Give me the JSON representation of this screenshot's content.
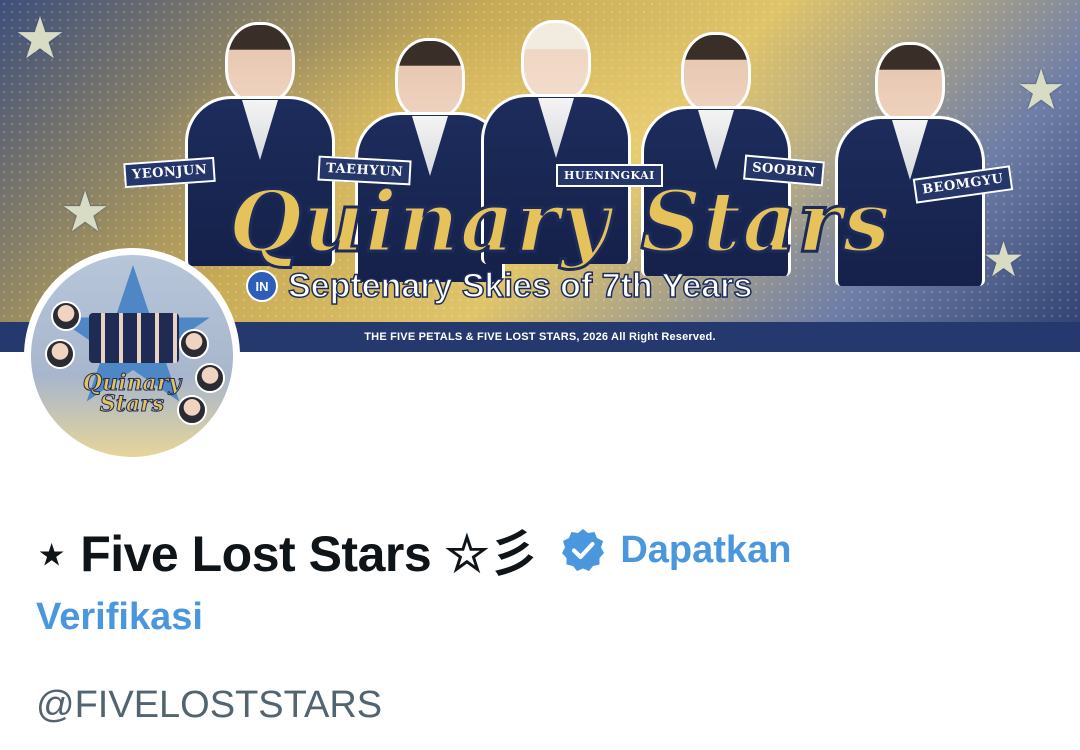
{
  "banner": {
    "title": "Quinary Stars",
    "in_badge": "IN",
    "subtitle": "Septenary Skies of 7th Years",
    "footer": "THE FIVE PETALS & FIVE LOST STARS, 2026 All Right Reserved.",
    "members": [
      "YEONJUN",
      "TAEHYUN",
      "HUENINGKAI",
      "SOOBIN",
      "BEOMGYU"
    ]
  },
  "avatar": {
    "title": "Quinary Stars"
  },
  "profile": {
    "display_name": "⋆ Five Lost Stars ☆彡",
    "verified_icon": "verified-badge-icon",
    "get_verified_part1": "Dapatkan",
    "get_verified_part2": "Verifikasi",
    "handle": "@FIVELOSTSTARS"
  },
  "colors": {
    "accent": "#4a97dd",
    "handle": "#536471",
    "text": "#0f1419",
    "banner_navy": "#25396f",
    "banner_gold": "#e6c25b"
  }
}
